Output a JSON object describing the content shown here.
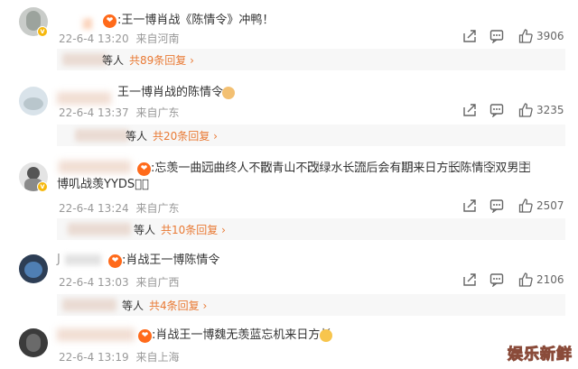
{
  "comments": [
    {
      "username": "道",
      "badge": "❤",
      "text": ":王一博肖战《陈情令》冲鸭！",
      "time": "22-6-4 13:20",
      "location": "来自河南",
      "likes": "3906",
      "reply_suffix": "等人",
      "reply_more": "共89条回复 ›"
    },
    {
      "username": "",
      "badge": "",
      "text": "王一博肖战的陈情令",
      "time": "22-6-4 13:37",
      "location": "来自广东",
      "likes": "3235",
      "reply_suffix": "等人",
      "reply_more": "共20条回复 ›"
    },
    {
      "username": "",
      "badge": "❤",
      "text": ":忘羡一曲远⃞曲终人不散⃞青山不改⃞绿水长流⃞后会有期⃞来日方长⃞陈情令⃞双男主⃞",
      "text2": "博叽战羡YYDS⃞⃞",
      "time": "22-6-4 13:24",
      "location": "来自广东",
      "likes": "2507",
      "reply_suffix": "等人",
      "reply_more": "共10条回复 ›"
    },
    {
      "username": "J",
      "badge": "❤",
      "text": ":肖战王一博陈情令",
      "time": "22-6-4 13:03",
      "location": "来自广西",
      "likes": "2106",
      "reply_suffix": "等人",
      "reply_more": "共4条回复 ›"
    },
    {
      "username": "",
      "badge": "❤",
      "text": ":肖战王一博魏无羡蓝忘机来日方长",
      "time": "22-6-4 13:19",
      "location": "来自上海",
      "likes": ""
    }
  ],
  "icons": {
    "share": "share-icon",
    "comment": "comment-icon",
    "like": "like-icon"
  },
  "colors": {
    "accent": "#e97a35",
    "meta": "#999999",
    "badge": "#ff6a1a"
  },
  "watermark": "娱乐新鲜"
}
